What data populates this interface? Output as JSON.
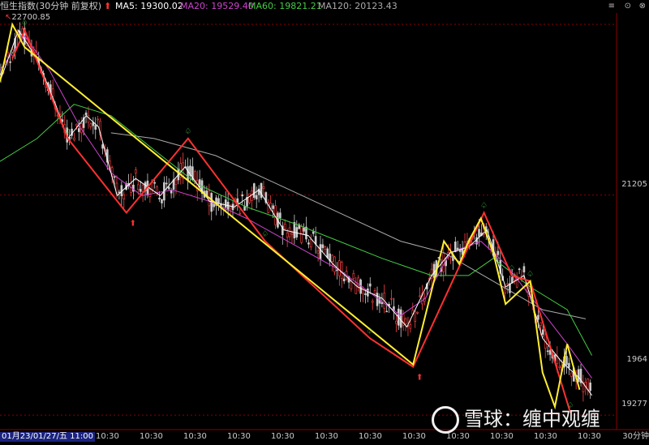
{
  "header": {
    "title": "恒生指数(30分钟 前复权)",
    "ma5": "MA5: 19300.02",
    "ma20": "MA20: 19529.40",
    "ma60": "MA60: 19821.21",
    "ma120": "MA120: 20123.43",
    "colors": {
      "title": "#cccccc",
      "ma5": "#ffffff",
      "ma20": "#cc44cc",
      "ma60": "#44cc44",
      "ma120": "#aaaaaa"
    }
  },
  "window_controls": {
    "menu_icon": "≡",
    "up_icon": "⊙",
    "close_icon": "⊗"
  },
  "price_labels": {
    "high": "22700.85",
    "mid": "21205",
    "low": "19277",
    "current": "1964"
  },
  "x_axis": {
    "start_label": "01月23/01/27/五 11:00",
    "tick_label": "10:30",
    "period": "30分钟"
  },
  "watermark": {
    "text": "雪球：缠中观缠"
  },
  "chart_data": {
    "type": "line",
    "title": "恒生指数(30分钟 前复权)",
    "ylim": [
      19150,
      22800
    ],
    "price_marks": [
      22700.85,
      21205,
      19277
    ],
    "series": [
      {
        "name": "MA120",
        "color": "#aaaaaa",
        "points": [
          [
            0.18,
            21750
          ],
          [
            0.25,
            21700
          ],
          [
            0.35,
            21550
          ],
          [
            0.45,
            21300
          ],
          [
            0.55,
            21050
          ],
          [
            0.65,
            20800
          ],
          [
            0.72,
            20700
          ],
          [
            0.8,
            20450
          ],
          [
            0.88,
            20200
          ],
          [
            0.95,
            20120
          ]
        ]
      },
      {
        "name": "MA60",
        "color": "#44cc44",
        "points": [
          [
            0.0,
            21500
          ],
          [
            0.06,
            21700
          ],
          [
            0.12,
            22000
          ],
          [
            0.18,
            21900
          ],
          [
            0.25,
            21600
          ],
          [
            0.32,
            21300
          ],
          [
            0.4,
            21100
          ],
          [
            0.48,
            20950
          ],
          [
            0.55,
            20800
          ],
          [
            0.62,
            20650
          ],
          [
            0.7,
            20500
          ],
          [
            0.76,
            20500
          ],
          [
            0.8,
            20650
          ],
          [
            0.86,
            20400
          ],
          [
            0.92,
            20200
          ],
          [
            0.96,
            19800
          ]
        ]
      },
      {
        "name": "MA20",
        "color": "#cc44cc",
        "points": [
          [
            0.0,
            22300
          ],
          [
            0.04,
            22600
          ],
          [
            0.08,
            22300
          ],
          [
            0.13,
            21800
          ],
          [
            0.18,
            21400
          ],
          [
            0.23,
            21200
          ],
          [
            0.28,
            21250
          ],
          [
            0.34,
            21150
          ],
          [
            0.4,
            21000
          ],
          [
            0.45,
            20850
          ],
          [
            0.5,
            20700
          ],
          [
            0.55,
            20550
          ],
          [
            0.6,
            20350
          ],
          [
            0.65,
            20150
          ],
          [
            0.69,
            20300
          ],
          [
            0.73,
            20700
          ],
          [
            0.78,
            20800
          ],
          [
            0.82,
            20600
          ],
          [
            0.87,
            20250
          ],
          [
            0.92,
            19900
          ],
          [
            0.96,
            19600
          ]
        ]
      },
      {
        "name": "MA5",
        "color": "#ffffff",
        "points": [
          [
            0.0,
            22200
          ],
          [
            0.03,
            22650
          ],
          [
            0.06,
            22400
          ],
          [
            0.09,
            22000
          ],
          [
            0.11,
            21700
          ],
          [
            0.14,
            21900
          ],
          [
            0.16,
            21800
          ],
          [
            0.19,
            21200
          ],
          [
            0.22,
            21350
          ],
          [
            0.26,
            21200
          ],
          [
            0.3,
            21450
          ],
          [
            0.34,
            21150
          ],
          [
            0.38,
            21100
          ],
          [
            0.42,
            21250
          ],
          [
            0.46,
            20900
          ],
          [
            0.5,
            20850
          ],
          [
            0.54,
            20600
          ],
          [
            0.58,
            20400
          ],
          [
            0.62,
            20300
          ],
          [
            0.66,
            20050
          ],
          [
            0.7,
            20500
          ],
          [
            0.73,
            20700
          ],
          [
            0.76,
            20750
          ],
          [
            0.79,
            20900
          ],
          [
            0.82,
            20400
          ],
          [
            0.85,
            20500
          ],
          [
            0.88,
            19950
          ],
          [
            0.91,
            19750
          ],
          [
            0.94,
            19600
          ],
          [
            0.96,
            19450
          ]
        ]
      }
    ],
    "zigzag": [
      {
        "color": "#ff3030",
        "points": [
          [
            0.02,
            22400
          ],
          [
            0.04,
            22650
          ],
          [
            0.11,
            21700
          ],
          [
            0.205,
            21050
          ],
          [
            0.305,
            21700
          ],
          [
            0.43,
            20800
          ],
          [
            0.6,
            19950
          ],
          [
            0.67,
            19700
          ],
          [
            0.785,
            21050
          ],
          [
            0.83,
            20500
          ],
          [
            0.86,
            20450
          ],
          [
            0.925,
            19300
          ]
        ]
      },
      {
        "color": "#ffee33",
        "points": [
          [
            0.0,
            22200
          ],
          [
            0.02,
            22700
          ],
          [
            0.04,
            22500
          ],
          [
            0.67,
            19720
          ],
          [
            0.72,
            20800
          ],
          [
            0.745,
            20600
          ],
          [
            0.76,
            20800
          ],
          [
            0.78,
            21000
          ],
          [
            0.8,
            20700
          ],
          [
            0.82,
            20250
          ],
          [
            0.86,
            20450
          ],
          [
            0.88,
            19650
          ],
          [
            0.9,
            19350
          ],
          [
            0.92,
            19900
          ],
          [
            0.94,
            19500
          ]
        ]
      }
    ],
    "candles_seed": 42
  }
}
